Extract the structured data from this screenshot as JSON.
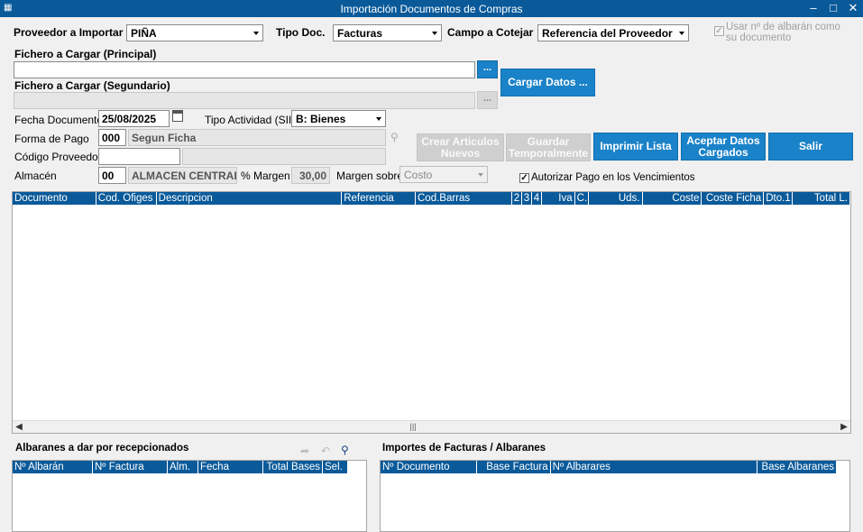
{
  "window": {
    "title": "Importación Documentos de Compras",
    "app_icon": "app-icon",
    "minimize": "minimize-icon",
    "maximize": "maximize-icon",
    "close": "close-icon"
  },
  "header": {
    "proveedor_label": "Proveedor a Importar",
    "proveedor_value": "PIÑA",
    "tipo_doc_label": "Tipo Doc.",
    "tipo_doc_value": "Facturas",
    "campo_label": "Campo a Cotejar",
    "campo_value": "Referencia del Proveedor",
    "albaran_checkbox_label": "Usar nº de albarán como su documento"
  },
  "files": {
    "principal_label": "Fichero a Cargar (Principal)",
    "principal_value": "",
    "secundario_label": "Fichero a Cargar (Segundario)",
    "secundario_value": "",
    "browse_label": "...",
    "cargar_label": "Cargar Datos ..."
  },
  "form": {
    "fecha_label": "Fecha Documentos",
    "fecha_value": "25/08/2025",
    "tipo_actividad_label": "Tipo Actividad (SII)",
    "tipo_actividad_value": "B: Bienes",
    "forma_pago_label": "Forma de Pago",
    "forma_pago_code": "000",
    "forma_pago_desc": "Segun Ficha",
    "codigo_proveedor_label": "Código Proveedor",
    "codigo_proveedor_value": "",
    "codigo_proveedor_desc": "",
    "almacen_label": "Almacén",
    "almacen_code": "00",
    "almacen_desc": "ALMACEN CENTRAL",
    "margen_label": "% Margen",
    "margen_value": "30,00",
    "margen_sobre_label": "Margen sobre",
    "margen_sobre_value": "Costo",
    "autorizar_label": "Autorizar Pago en los Vencimientos"
  },
  "actions": {
    "crear_line1": "Crear Articulos",
    "crear_line2": "Nuevos",
    "guardar_line1": "Guardar",
    "guardar_line2": "Temporalmente",
    "imprimir": "Imprimir Lista",
    "aceptar_line1": "Aceptar Datos",
    "aceptar_line2": "Cargados",
    "salir": "Salir"
  },
  "main_grid": {
    "columns": [
      "Documento",
      "Cod. Ofiges",
      "Descripcion",
      "Referencia",
      "Cod.Barras",
      "2",
      "3",
      "4",
      "Iva",
      "C.",
      "Uds.",
      "Coste",
      "Coste Ficha",
      "Dto.1",
      "Total L."
    ]
  },
  "albaranes": {
    "title": "Albaranes a dar por recepcionados",
    "columns": [
      "Nº Albarán",
      "Nº Factura",
      "Alm.",
      "Fecha",
      "Total Bases",
      "Sel."
    ]
  },
  "importes": {
    "title": "Importes de Facturas / Albaranes",
    "columns": [
      "Nº Documento",
      "Base Factura",
      "Nº Albarares",
      "Base Albaranes"
    ]
  },
  "colors": {
    "accent": "#1a82c8",
    "titlebar": "#0a5a9a",
    "header": "#0a5a9a"
  }
}
